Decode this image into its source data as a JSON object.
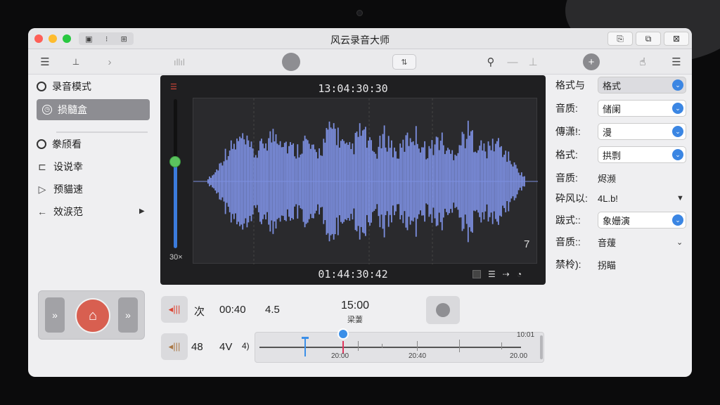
{
  "window": {
    "title": "风云录音大师"
  },
  "titlebar": {
    "left_group_icons": [
      "sidebar-toggle-icon",
      "info-icon",
      "grid-icon"
    ],
    "right_buttons": [
      "copy-icon",
      "window-icon",
      "close-window-icon"
    ]
  },
  "toolbar": {
    "pill_label": "⇅",
    "plus_label": "+"
  },
  "sidebar": {
    "item_record_mode": "录音模式",
    "item_selected": "损髓盒",
    "item_radio2": "豢颀看",
    "item_settings": "设说幸",
    "item_preview": "预貓速",
    "item_back": "效涙范"
  },
  "waveform": {
    "time_top": "13:04:30:30",
    "time_bottom": "01:44:30:42",
    "volume_label": "30×",
    "corner_num": "7",
    "volume_level": 0.58,
    "amplitudes": [
      0.05,
      0.1,
      0.2,
      0.35,
      0.5,
      0.55,
      0.6,
      0.7,
      0.62,
      0.55,
      0.45,
      0.5,
      0.65,
      0.7,
      0.75,
      0.8,
      0.72,
      0.6,
      0.55,
      0.5,
      0.6,
      0.68,
      0.55,
      0.45,
      0.5,
      0.65,
      0.8,
      0.9,
      0.75,
      0.6,
      0.5,
      0.55,
      0.7,
      0.85,
      0.7,
      0.55,
      0.45,
      0.6,
      0.75,
      0.65,
      0.5,
      0.45,
      0.6,
      0.7,
      0.8,
      0.72,
      0.6,
      0.5,
      0.55,
      0.65,
      0.7,
      0.55,
      0.45,
      0.5,
      0.6,
      0.75,
      0.8,
      0.7,
      0.6,
      0.55,
      0.5,
      0.6,
      0.65,
      0.55,
      0.45,
      0.35,
      0.25,
      0.15,
      0.08
    ]
  },
  "transport": {
    "row1_a": "次",
    "row1_b": "00:40",
    "row1_c": "4.5",
    "row2_a": "48",
    "row2_b": "4V",
    "row2_c": "4)",
    "big_time": "15:00",
    "big_sub": "梁萋",
    "tl_label1": "20:00",
    "tl_label2": "20:40",
    "tl_label3": "20.00",
    "tl_label_top": "10:01",
    "playhead_position": 0.3
  },
  "settings": {
    "row1_label": "格式与",
    "row1_value": "格式",
    "row2_label": "音质:",
    "row2_value": "储阑",
    "row3_label": "傳潇!:",
    "row3_value": "漫",
    "row4_label": "格式:",
    "row4_value": "拱剽",
    "row5_label": "音质:",
    "row5_value": "烬濒",
    "row6_label": "砕风以:",
    "row6_value": "4L.b!",
    "row7_label": "跋式::",
    "row7_value": "象姗演",
    "row8_label": "音质::",
    "row8_value": "音蕿",
    "row9_label": "禁柃):",
    "row9_value": "拐瞄"
  },
  "colors": {
    "waveform": "#7c8fe0",
    "record": "#d85f50",
    "accent": "#3b86e3",
    "window_bg": "#efeff1"
  }
}
